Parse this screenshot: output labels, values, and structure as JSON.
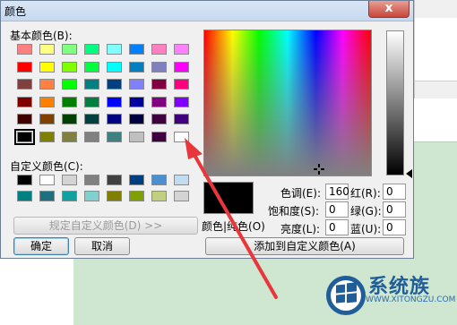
{
  "dialog": {
    "title": "颜色",
    "close_glyph": "x",
    "basic_colors_label": "基本颜色(B):",
    "custom_colors_label": "自定义颜色(C):",
    "define_custom_label": "规定自定义颜色(D) >>",
    "ok_label": "确定",
    "cancel_label": "取消",
    "add_custom_label": "添加到自定义颜色(A)",
    "color_solid_label": "颜色|纯色(O)",
    "basic_colors": [
      [
        "#ff8080",
        "#ffff80",
        "#80ff80",
        "#00ff80",
        "#80ffff",
        "#0080ff",
        "#ff80c0",
        "#ff80ff"
      ],
      [
        "#ff0000",
        "#ffff00",
        "#80ff00",
        "#00ff40",
        "#00ffff",
        "#0080c0",
        "#8080c0",
        "#ff00ff"
      ],
      [
        "#804040",
        "#ff8040",
        "#00ff00",
        "#008080",
        "#004080",
        "#8080ff",
        "#800040",
        "#ff0080"
      ],
      [
        "#800000",
        "#ff8000",
        "#008000",
        "#008040",
        "#0000ff",
        "#0000a0",
        "#800080",
        "#8000ff"
      ],
      [
        "#400000",
        "#804000",
        "#004000",
        "#004040",
        "#000080",
        "#000040",
        "#400040",
        "#400080"
      ],
      [
        "#000000",
        "#808000",
        "#808040",
        "#808080",
        "#408080",
        "#c0c0c0",
        "#400040",
        "#ffffff"
      ]
    ],
    "custom_colors": [
      [
        "#000000",
        "#ffffff",
        "#d4d4d4",
        "#808080",
        "#404040",
        "#004080",
        "#4a90d0",
        "#c0dcf0"
      ],
      [
        "#008080",
        "#1e7080",
        "#10a0a0",
        "#80d0d0",
        "#808000",
        "#80a000",
        "#c0d080",
        "#d4d4d4"
      ]
    ],
    "fields": {
      "hue_label": "色调(E):",
      "hue": "160",
      "sat_label": "饱和度(S):",
      "sat": "0",
      "lum_label": "亮度(L):",
      "lum": "0",
      "red_label": "红(R):",
      "red": "0",
      "green_label": "绿(G):",
      "green": "0",
      "blue_label": "蓝(U):",
      "blue": "0"
    }
  },
  "watermark": {
    "brand": "系统族",
    "url": "WWW.XITONGZU.COM"
  },
  "colors": {
    "arrow": "#e8373a",
    "logo_blue": "#1f5e99"
  }
}
